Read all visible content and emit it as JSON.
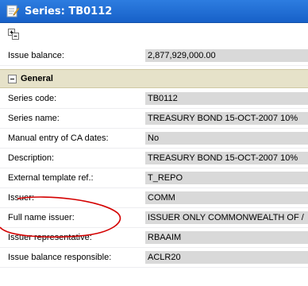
{
  "window": {
    "title": "Series: TB0112",
    "icon": "edit-document-icon"
  },
  "toolbar": {
    "expand_icon": "expand-all-icon"
  },
  "issue_balance": {
    "label": "Issue balance:",
    "value": "2,877,929,000.00"
  },
  "section": {
    "title": "General",
    "expanded": true
  },
  "fields": [
    {
      "label": "Series code:",
      "value": "TB0112"
    },
    {
      "label": "Series name:",
      "value": "TREASURY BOND 15-OCT-2007 10%"
    },
    {
      "label": "Manual entry of CA dates:",
      "value": "No"
    },
    {
      "label": "Description:",
      "value": "TREASURY BOND 15-OCT-2007 10%"
    },
    {
      "label": "External template ref.:",
      "value": "T_REPO"
    },
    {
      "label": "Issuer:",
      "value": "COMM"
    },
    {
      "label": "Full name issuer:",
      "value": "ISSUER ONLY COMMONWEALTH OF /"
    },
    {
      "label": "Issuer representative:",
      "value": "RBAAIM"
    },
    {
      "label": "Issue balance responsible:",
      "value": "ACLR20"
    }
  ],
  "colors": {
    "titlebar": "#1e6fd6",
    "section_header": "#e6e2c9",
    "value_bg": "#d9d9d9",
    "annotation": "#d40000"
  }
}
